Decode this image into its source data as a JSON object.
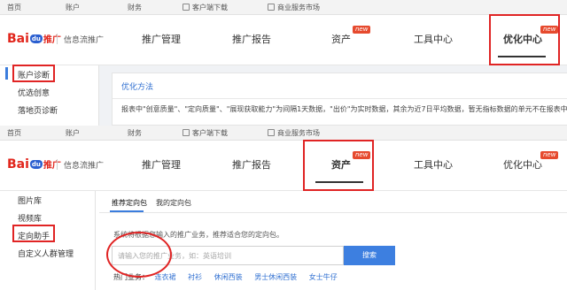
{
  "top_links": [
    "首页",
    "账户",
    "财务",
    "客户端下载",
    "商业服务市场"
  ],
  "brand": {
    "bai": "Bai",
    "paw": "du",
    "tuiguang": "推广",
    "product": "信息流推广"
  },
  "nav": [
    {
      "label": "推广管理"
    },
    {
      "label": "推广报告"
    },
    {
      "label": "资产",
      "tag": "new"
    },
    {
      "label": "工具中心"
    },
    {
      "label": "优化中心",
      "tag": "new"
    }
  ],
  "panel1": {
    "sidebar": [
      "账户诊断",
      "优选创意",
      "落地页诊断"
    ],
    "card_title": "优化方法",
    "card_text": "报表中\"创意质量\"、\"定向质量\"、\"展现获取能力\"为间隔1天数据，\"出价\"为实时数据，其余为近7日平均数据，暂无指标数据的单元不在报表中展示或"
  },
  "panel2": {
    "sidebar": [
      "图片库",
      "视频库",
      "定向助手",
      "自定义人群管理"
    ],
    "tabs": [
      "推荐定向包",
      "我的定向包"
    ],
    "hint": "系统将根据您输入的推广业务，推荐适合您的定向包。",
    "search_placeholder": "请输入您的推广业务，如：英语培训",
    "search_button": "搜索",
    "hot_label": "热门业务：",
    "hot_keywords": [
      "连衣裙",
      "衬衫",
      "休闲西装",
      "男士休闲西装",
      "女士牛仔"
    ]
  },
  "colors": {
    "accent_blue": "#3d7fe0",
    "baidu_red": "#e1261c",
    "annotation_red": "#e02424",
    "new_badge": "#e64a2e"
  },
  "icons": {
    "download": "client-download-icon",
    "market": "store-icon"
  }
}
